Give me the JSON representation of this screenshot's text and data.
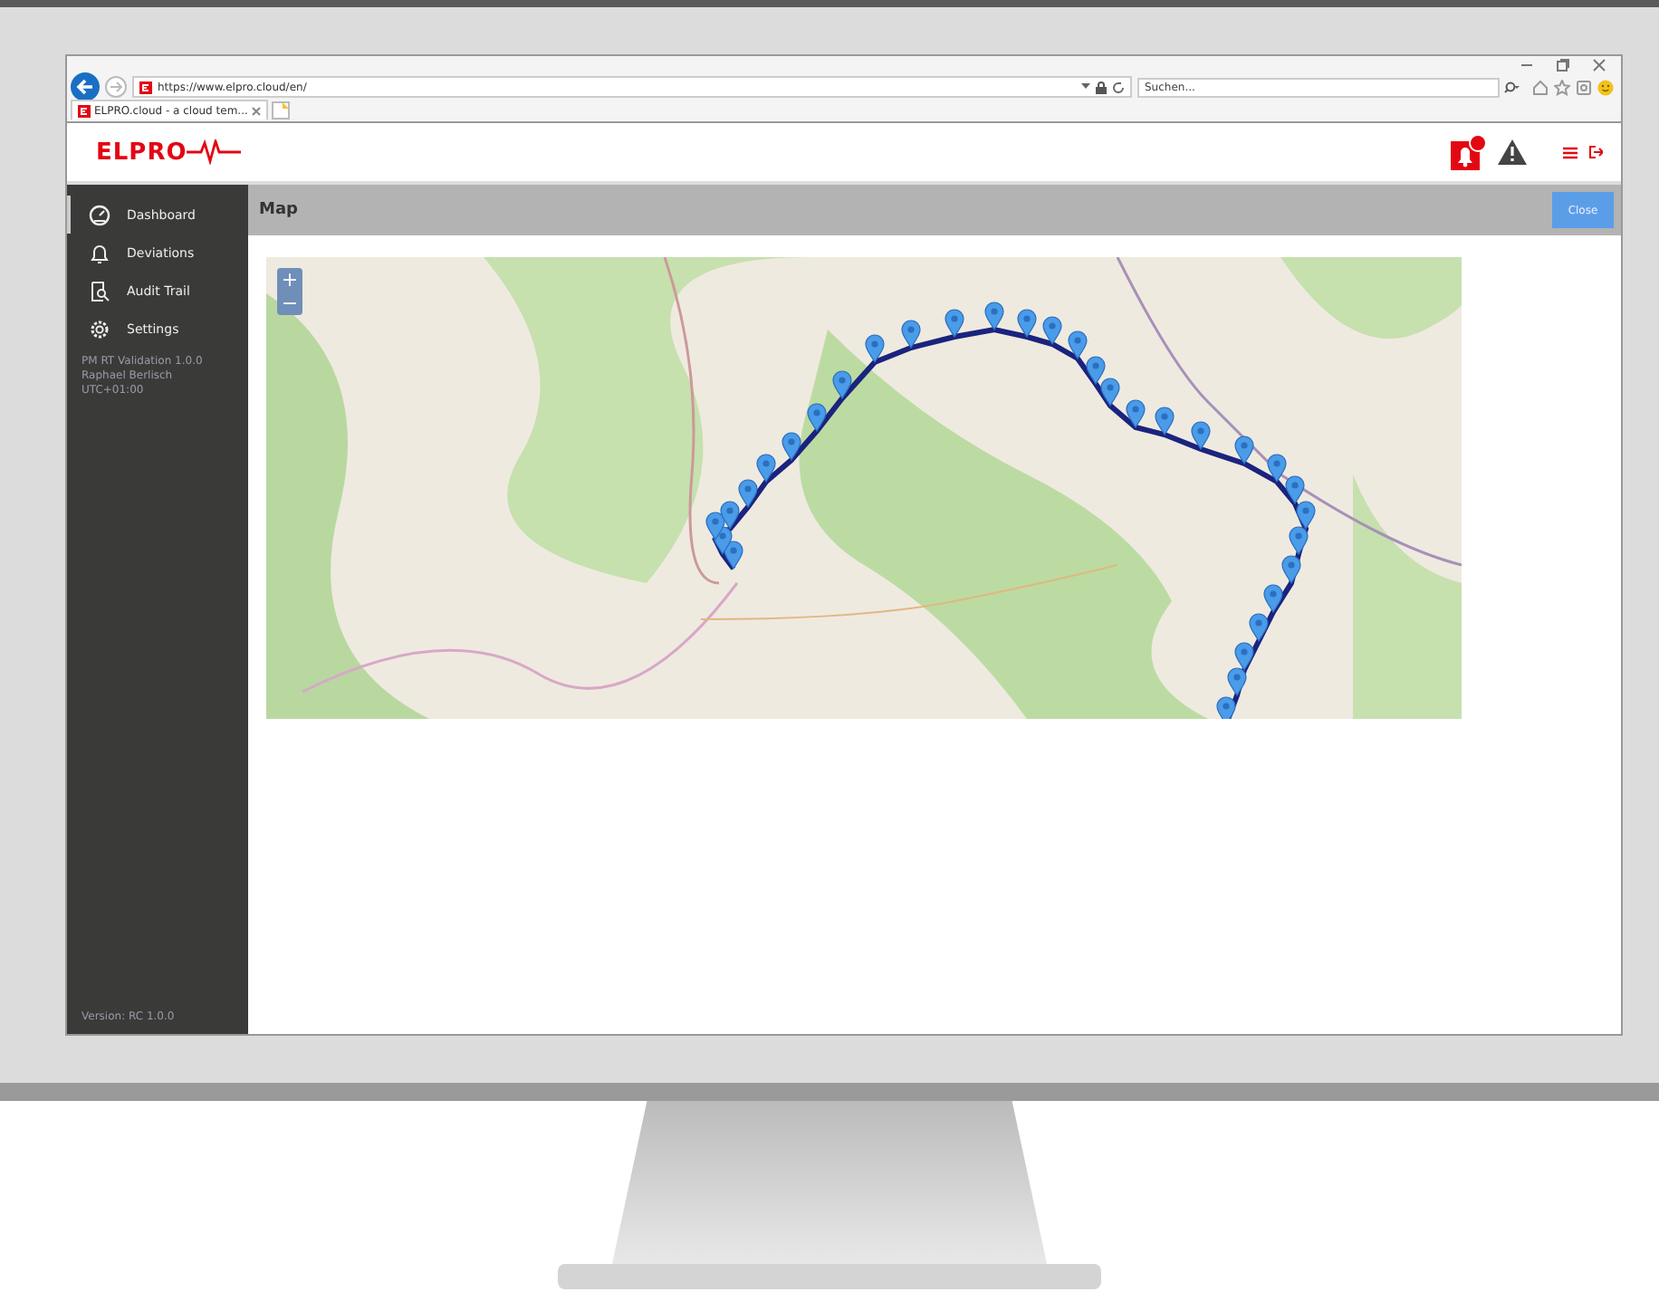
{
  "browser": {
    "url": "https://www.elpro.cloud/en/",
    "search": {
      "placeholder": "Suchen..."
    },
    "tabs": [
      {
        "label": "ELPRO.cloud - a cloud tem...",
        "selected": true
      }
    ]
  },
  "header": {
    "logo": "ELPRO",
    "notifications": true
  },
  "sidebar": {
    "items": [
      {
        "label": "Dashboard",
        "kind": "gauge",
        "selected": true
      },
      {
        "label": "Deviations",
        "kind": "bell",
        "selected": false
      },
      {
        "label": "Audit Trail",
        "kind": "audit",
        "selected": false
      },
      {
        "label": "Settings",
        "kind": "gear",
        "selected": false
      }
    ],
    "info": [
      "PM RT Validation 1.0.0",
      "Raphael Berlisch",
      "UTC+01:00"
    ],
    "version": "Version: RC 1.0.0"
  },
  "page": {
    "title": "Map",
    "close_button": "Close"
  },
  "map": {
    "zoom_in": "+",
    "zoom_out": "−"
  }
}
